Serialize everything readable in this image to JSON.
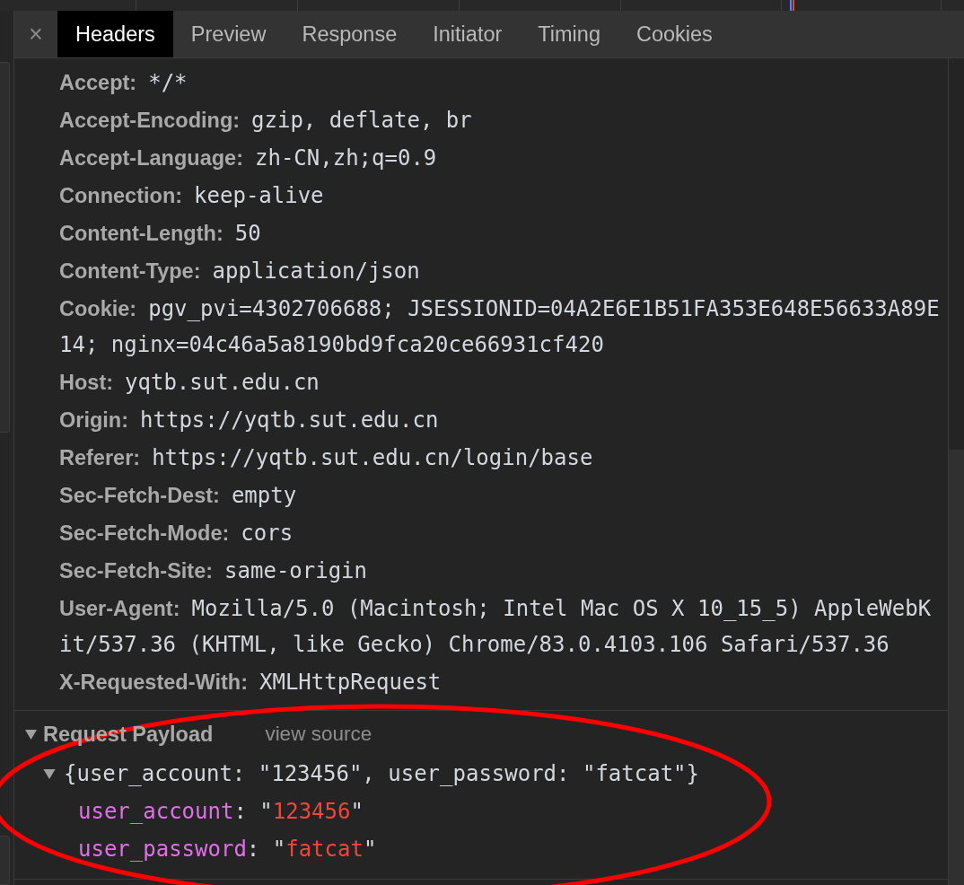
{
  "tabs": {
    "close": "×",
    "items": [
      {
        "label": "Headers",
        "selected": true
      },
      {
        "label": "Preview",
        "selected": false
      },
      {
        "label": "Response",
        "selected": false
      },
      {
        "label": "Initiator",
        "selected": false
      },
      {
        "label": "Timing",
        "selected": false
      },
      {
        "label": "Cookies",
        "selected": false
      }
    ]
  },
  "request_headers": [
    {
      "name": "Accept:",
      "value": "*/*"
    },
    {
      "name": "Accept-Encoding:",
      "value": "gzip, deflate, br"
    },
    {
      "name": "Accept-Language:",
      "value": "zh-CN,zh;q=0.9"
    },
    {
      "name": "Connection:",
      "value": "keep-alive"
    },
    {
      "name": "Content-Length:",
      "value": "50"
    },
    {
      "name": "Content-Type:",
      "value": "application/json"
    },
    {
      "name": "Cookie:",
      "value": "pgv_pvi=4302706688; JSESSIONID=04A2E6E1B51FA353E648E56633A89E14; nginx=04c46a5a8190bd9fca20ce66931cf420"
    },
    {
      "name": "Host:",
      "value": "yqtb.sut.edu.cn"
    },
    {
      "name": "Origin:",
      "value": "https://yqtb.sut.edu.cn"
    },
    {
      "name": "Referer:",
      "value": "https://yqtb.sut.edu.cn/login/base"
    },
    {
      "name": "Sec-Fetch-Dest:",
      "value": "empty"
    },
    {
      "name": "Sec-Fetch-Mode:",
      "value": "cors"
    },
    {
      "name": "Sec-Fetch-Site:",
      "value": "same-origin"
    },
    {
      "name": "User-Agent:",
      "value": "Mozilla/5.0 (Macintosh; Intel Mac OS X 10_15_5) AppleWebKit/537.36 (KHTML, like Gecko) Chrome/83.0.4103.106 Safari/537.36"
    },
    {
      "name": "X-Requested-With:",
      "value": "XMLHttpRequest"
    }
  ],
  "request_payload": {
    "title": "Request Payload",
    "expanded": true,
    "view_source": "view source",
    "object": {
      "summary": "{user_account: \"123456\", user_password: \"fatcat\"}",
      "expanded": true,
      "properties": [
        {
          "key": "user_account",
          "separator": ": \"",
          "value": "123456",
          "end": "\""
        },
        {
          "key": "user_password",
          "separator": ": \"",
          "value": "fatcat",
          "end": "\""
        }
      ]
    }
  },
  "annotation": {
    "kind": "ellipse"
  }
}
